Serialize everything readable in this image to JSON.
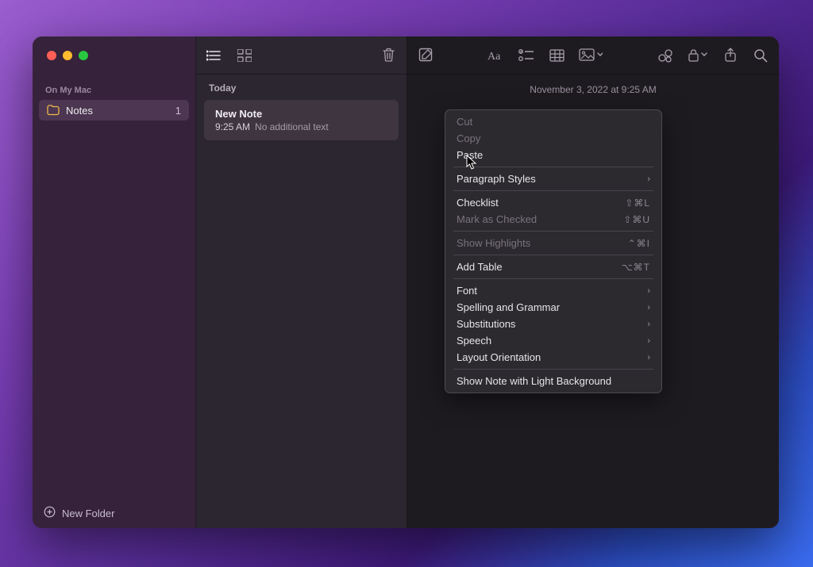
{
  "window": {
    "sidebar": {
      "section_label": "On My Mac",
      "folders": [
        {
          "name": "Notes",
          "count": "1"
        }
      ],
      "new_folder_label": "New Folder"
    },
    "notes_list": {
      "section_header": "Today",
      "items": [
        {
          "title": "New Note",
          "time": "9:25 AM",
          "preview": "No additional text"
        }
      ]
    },
    "editor": {
      "timestamp": "November 3, 2022 at 9:25 AM"
    }
  },
  "context_menu": {
    "groups": [
      [
        {
          "label": "Cut",
          "enabled": false
        },
        {
          "label": "Copy",
          "enabled": false
        },
        {
          "label": "Paste",
          "enabled": true
        }
      ],
      [
        {
          "label": "Paragraph Styles",
          "enabled": true,
          "submenu": true
        }
      ],
      [
        {
          "label": "Checklist",
          "enabled": true,
          "shortcut": "⇧⌘L"
        },
        {
          "label": "Mark as Checked",
          "enabled": false,
          "shortcut": "⇧⌘U"
        }
      ],
      [
        {
          "label": "Show Highlights",
          "enabled": false,
          "shortcut": "⌃⌘I"
        }
      ],
      [
        {
          "label": "Add Table",
          "enabled": true,
          "shortcut": "⌥⌘T"
        }
      ],
      [
        {
          "label": "Font",
          "enabled": true,
          "submenu": true
        },
        {
          "label": "Spelling and Grammar",
          "enabled": true,
          "submenu": true
        },
        {
          "label": "Substitutions",
          "enabled": true,
          "submenu": true
        },
        {
          "label": "Speech",
          "enabled": true,
          "submenu": true
        },
        {
          "label": "Layout Orientation",
          "enabled": true,
          "submenu": true
        }
      ],
      [
        {
          "label": "Show Note with Light Background",
          "enabled": true
        }
      ]
    ]
  }
}
